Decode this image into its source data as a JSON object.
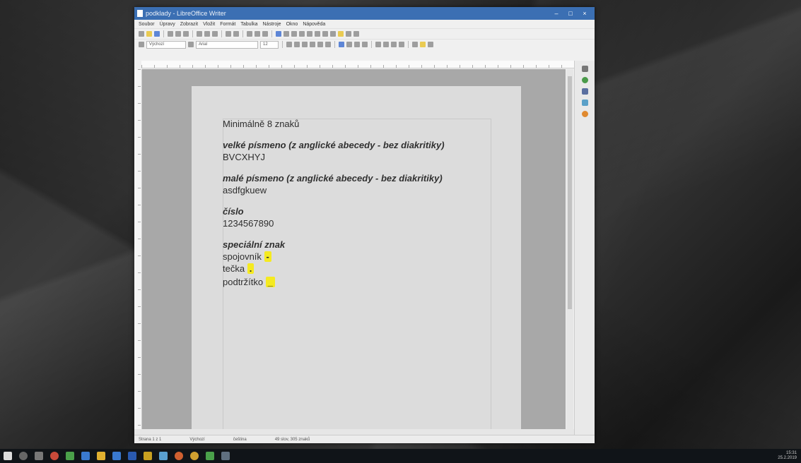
{
  "window": {
    "title": "podklady - LibreOffice Writer",
    "controls": [
      "–",
      "□",
      "×"
    ]
  },
  "menu": [
    "Soubor",
    "Úpravy",
    "Zobrazit",
    "Vložit",
    "Formát",
    "Tabulka",
    "Nástroje",
    "Okno",
    "Nápověda"
  ],
  "toolbar": {
    "style_value": "Výchozí",
    "font_value": "Arial",
    "size_value": "12"
  },
  "document": {
    "intro": "Minimálně 8 znaků",
    "sections": [
      {
        "heading": "velké písmeno (z anglické abecedy - bez diakritiky)",
        "value": "BVCXHYJ"
      },
      {
        "heading": "malé písmeno (z anglické abecedy - bez diakritiky)",
        "value": "asdfgkuew"
      },
      {
        "heading": "číslo",
        "value": "1234567890"
      }
    ],
    "special": {
      "heading": "speciální znak",
      "items": [
        {
          "label": "spojovník",
          "char": "-"
        },
        {
          "label": "tečka",
          "char": "."
        },
        {
          "label": "podtržítko",
          "char": "_"
        }
      ]
    }
  },
  "statusbar": {
    "page": "Strana 1 z 1",
    "style": "Výchozí",
    "lang": "čeština",
    "words": "49 slov, 305 znaků"
  },
  "colors": {
    "titlebar": "#3b6fb3",
    "highlight": "#f5ea20",
    "taskbar": "#101418"
  },
  "taskbar": {
    "time": "15:31",
    "date": "25.2.2019",
    "icons": [
      "start-icon",
      "search-icon",
      "task-view-icon",
      "chrome-icon",
      "libreoffice-icon",
      "edge-icon",
      "explorer-icon",
      "store-icon",
      "mail-icon",
      "photos-icon",
      "firefox-icon",
      "media-icon",
      "excel-icon",
      "writer-icon"
    ]
  }
}
